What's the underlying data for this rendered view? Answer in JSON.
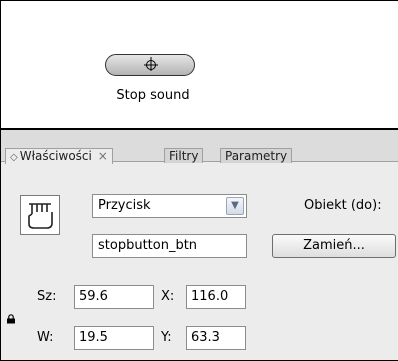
{
  "stage": {
    "button_label": "Stop sound"
  },
  "panel": {
    "tabs": [
      {
        "label": "Właściwości",
        "close": "×",
        "active": true
      },
      {
        "label": "Filtry",
        "active": false
      },
      {
        "label": "Parametry",
        "active": false
      }
    ],
    "symbol_icon": "button-symbol-icon",
    "type_select": {
      "value": "Przycisk"
    },
    "instance_name": {
      "value": "stopbutton_btn"
    },
    "object_label": "Obiekt (do):",
    "swap_button": "Zamień...",
    "dimensions": {
      "width_label": "Sz:",
      "width_value": "59.6",
      "height_label": "W:",
      "height_value": "19.5",
      "x_label": "X:",
      "x_value": "116.0",
      "y_label": "Y:",
      "y_value": "63.3"
    }
  },
  "colors": {
    "panel_bg": "#ececec",
    "tabstrip_bg": "#dcdcdc",
    "stage_bg": "#ffffff"
  }
}
